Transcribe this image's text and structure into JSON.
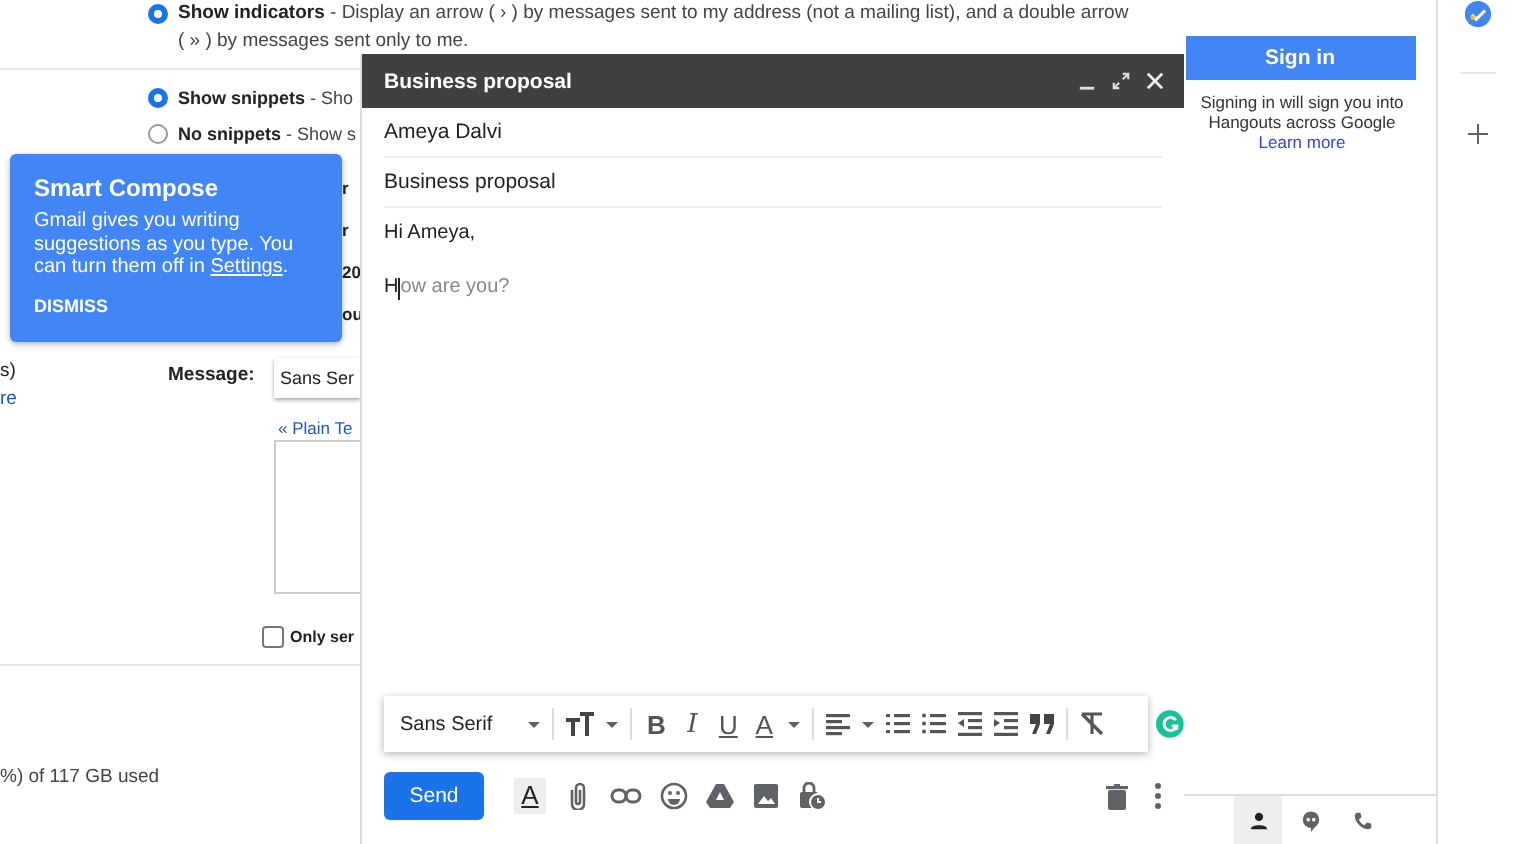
{
  "settings": {
    "indicators": {
      "label": "Show indicators",
      "text": " - Display an arrow ( › ) by messages sent to my address (not a mailing list), and a double arrow ( » ) by messages sent only to me.",
      "selected": true
    },
    "snippets": [
      {
        "label": "Show snippets",
        "text": " - Sho",
        "selected": true
      },
      {
        "label": "No snippets",
        "text": " - Show s",
        "selected": false
      }
    ],
    "fragments": [
      "r",
      "r",
      "20",
      "ou"
    ],
    "left_fragments": [
      {
        "kind": "text",
        "text": "s)"
      },
      {
        "kind": "link",
        "text": "re"
      }
    ],
    "signature": {
      "label": "Message:",
      "font": "Sans Ser",
      "plain_text_link": "« Plain Te",
      "only_send_label": "Only ser",
      "only_send_checked": false
    },
    "storage": "%) of 117 GB used"
  },
  "tooltip": {
    "title": "Smart Compose",
    "text_before": "Gmail gives you writing suggestions as you type. You can turn them off in ",
    "link": "Settings",
    "text_after": ".",
    "action": "DISMISS"
  },
  "compose": {
    "title": "Business proposal",
    "to": "Ameya Dalvi",
    "subject": "Business proposal",
    "greeting": "Hi Ameya,",
    "typed": "H",
    "suggestion": "ow are you?",
    "toolbar": {
      "font": "Sans Serif",
      "bold": "B",
      "italic": "I",
      "underline": "U",
      "text_color": "A"
    },
    "send": "Send",
    "format_glyph": "A"
  },
  "hangouts": {
    "sign_in": "Sign in",
    "message": "Signing in will sign you into Hangouts across Google",
    "learn_more": "Learn more",
    "tabs": [
      {
        "selected": true
      },
      {
        "selected": false
      },
      {
        "selected": false
      }
    ]
  }
}
